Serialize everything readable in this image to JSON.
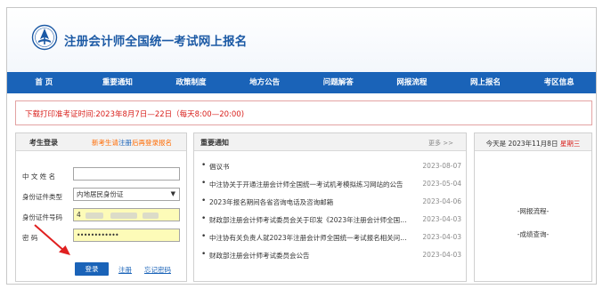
{
  "header": {
    "site_title": "注册会计师全国统一考试网上报名"
  },
  "nav": [
    "首 页",
    "重要通知",
    "政策制度",
    "地方公告",
    "问题解答",
    "网报流程",
    "网上报名",
    "考区信息"
  ],
  "notice": {
    "text": "下载打印准考证时间:2023年8月7日—22日（每天8:00—20:00)"
  },
  "login": {
    "title": "考生登录",
    "hint_prefix": "新考生请",
    "hint_link": "注册",
    "hint_suffix": "后再登录报名",
    "name_label": "中 文  姓 名",
    "id_type_label": "身份证件类型",
    "id_type_value": "内地居民身份证",
    "id_number_label": "身份证件号码",
    "id_number_visible": "4",
    "password_label": "密      码",
    "password_value": "••••••••••••",
    "login_button": "登录",
    "register_link": "注册",
    "forgot_link": "忘记密码"
  },
  "news": {
    "title": "重要通知",
    "more": "更多 >>",
    "items": [
      {
        "text": "倡议书",
        "date": "2023-08-07"
      },
      {
        "text": "中注协关于开通注册会计师全国统一考试机考模拟练习网站的公告",
        "date": "2023-05-04"
      },
      {
        "text": "2023年报名期间各省咨询电话及咨询邮箱",
        "date": "2023-04-06"
      },
      {
        "text": "财政部注册会计师考试委员会关于印发《2023年注册会计师全国统一考试报名简章》的通知",
        "date": "2023-04-03"
      },
      {
        "text": "中注协有关负责人就2023年注册会计师全国统一考试报名相关问题答记者问",
        "date": "2023-04-03"
      },
      {
        "text": "财政部注册会计师考试委员会公告",
        "date": "2023-04-03"
      }
    ]
  },
  "side": {
    "date_prefix": "今天是 2023年11月8日",
    "weekday": "星期三",
    "link1": "-网报流程-",
    "link2": "-成绩查询-"
  },
  "colors": {
    "brand_blue": "#1a63b8",
    "alert_red": "#d9211d",
    "hint_orange": "#ff6a00",
    "input_yellow": "#fdfbb8"
  }
}
